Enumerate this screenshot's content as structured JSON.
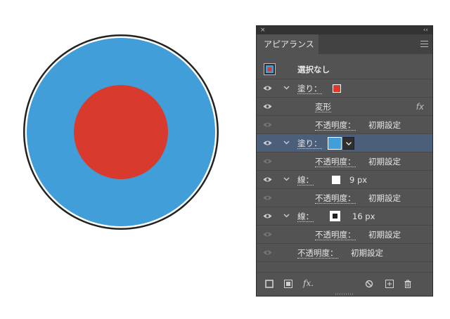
{
  "artwork": {
    "outer_fill": "#419ed9",
    "inner_fill": "#d83a2e",
    "stroke_outer": "#222222",
    "stroke_inner": "#ffffff"
  },
  "panel": {
    "close_glyph": "×",
    "collapse_glyph": "‹‹",
    "tab_label": "アピアランス",
    "header": {
      "label": "選択なし"
    },
    "rows": [
      {
        "label": "塗り：",
        "swatch": "#d83a2e"
      },
      {
        "label": "変形",
        "fx": "fx"
      },
      {
        "label": "不透明度：",
        "value": "初期設定"
      },
      {
        "label": "塗り：",
        "swatch": "#419ed9"
      },
      {
        "label": "不透明度：",
        "value": "初期設定"
      },
      {
        "label": "線：",
        "value": "9 px"
      },
      {
        "label": "不透明度：",
        "value": "初期設定"
      },
      {
        "label": "線：",
        "value": "16 px"
      },
      {
        "label": "不透明度：",
        "value": "初期設定"
      },
      {
        "label": "不透明度：",
        "value": "初期設定"
      }
    ],
    "footer": {
      "fx_label": "fx."
    },
    "colors": {
      "panel_bg": "#535353",
      "selected_row": "#4b5f7b",
      "title_bg": "#323232"
    }
  }
}
